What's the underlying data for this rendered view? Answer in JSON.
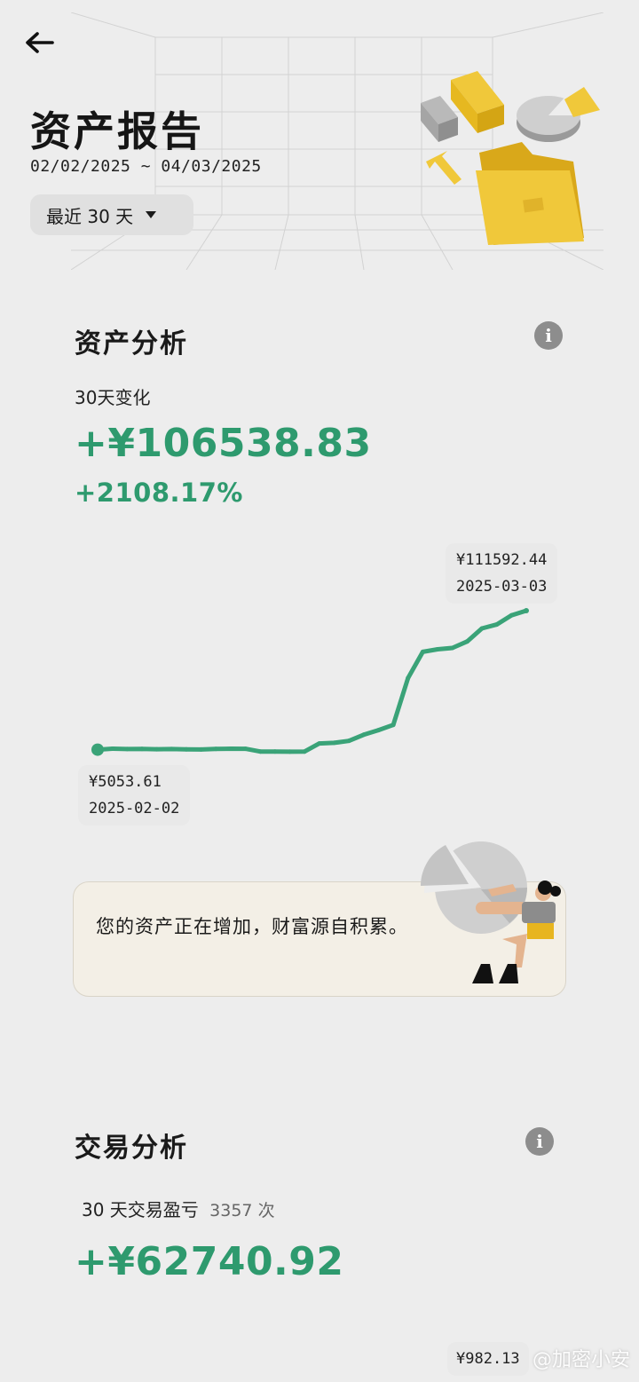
{
  "header": {
    "title": "资产报告",
    "date_range": "02/02/2025 ~ 04/03/2025",
    "range_select": "最近 30 天"
  },
  "asset_analysis": {
    "title": "资产分析",
    "change_label": "30天变化",
    "change_amount": "+¥106538.83",
    "change_percent": "+2108.17%",
    "max_point": {
      "value_label": "¥111592.44",
      "date": "2025-03-03"
    },
    "min_point": {
      "value_label": "¥5053.61",
      "date": "2025-02-02"
    },
    "message": "您的资产正在增加，财富源自积累。"
  },
  "chart_data": {
    "type": "line",
    "title": "",
    "xlabel": "",
    "ylabel": "",
    "x": [
      "2025-02-02",
      "2025-02-03",
      "2025-02-04",
      "2025-02-05",
      "2025-02-06",
      "2025-02-07",
      "2025-02-08",
      "2025-02-09",
      "2025-02-10",
      "2025-02-11",
      "2025-02-12",
      "2025-02-13",
      "2025-02-14",
      "2025-02-15",
      "2025-02-16",
      "2025-02-17",
      "2025-02-18",
      "2025-02-19",
      "2025-02-20",
      "2025-02-21",
      "2025-02-22",
      "2025-02-23",
      "2025-02-24",
      "2025-02-25",
      "2025-02-26",
      "2025-02-27",
      "2025-02-28",
      "2025-03-01",
      "2025-03-02",
      "2025-03-03"
    ],
    "series": [
      {
        "values": [
          5053.61,
          5800,
          5500,
          5600,
          5400,
          5500,
          5300,
          5200,
          5600,
          5800,
          5700,
          3600,
          3600,
          3500,
          3600,
          9800,
          10300,
          11800,
          16500,
          20000,
          24000,
          60000,
          80000,
          82000,
          83000,
          88000,
          98000,
          101000,
          108000,
          111592.44
        ]
      }
    ],
    "color": "#3aa378",
    "ylim": [
      0,
      111592.44
    ],
    "grid": false
  },
  "trade_analysis": {
    "title": "交易分析",
    "label": "30 天交易盈亏",
    "count": "3357 次",
    "pnl": "+¥62740.92",
    "partial_value": "¥982.13"
  },
  "watermark": "@加密小安",
  "colors": {
    "accent_green": "#2e9a6e",
    "background": "#ededed",
    "card_bg": "#f3efe6",
    "illustration_yellow": "#e7b51f"
  }
}
